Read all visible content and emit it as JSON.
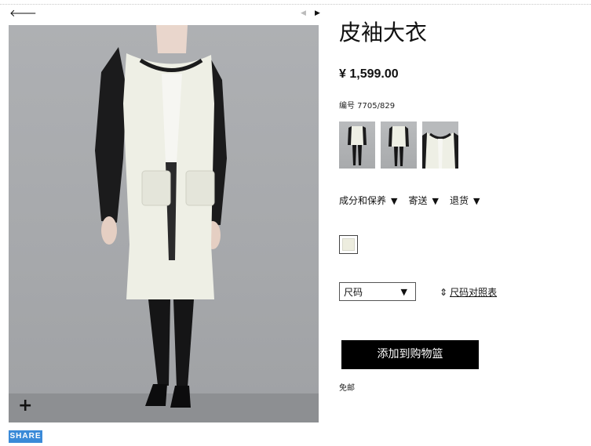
{
  "nav": {
    "back_icon": "arrow-left-icon",
    "prev_icon": "triangle-left-icon",
    "next_icon": "triangle-right-icon"
  },
  "product": {
    "title": "皮袖大衣",
    "price": "¥ 1,599.00",
    "reference": "编号 7705/829",
    "thumbnails": [
      "front-view",
      "back-view",
      "detail-view"
    ],
    "color_swatch": "#ededdf"
  },
  "info_tabs": [
    {
      "label": "成分和保养"
    },
    {
      "label": "寄送"
    },
    {
      "label": "退货"
    }
  ],
  "size": {
    "select_value": "尺码",
    "chart_label": "尺码对照表"
  },
  "actions": {
    "add_to_basket": "添加到购物篮",
    "shipping_note": "免邮",
    "share": "SHARE",
    "zoom_icon": "plus-icon"
  },
  "colors": {
    "accent_share": "#3a8ad8",
    "button_black": "#000000"
  }
}
